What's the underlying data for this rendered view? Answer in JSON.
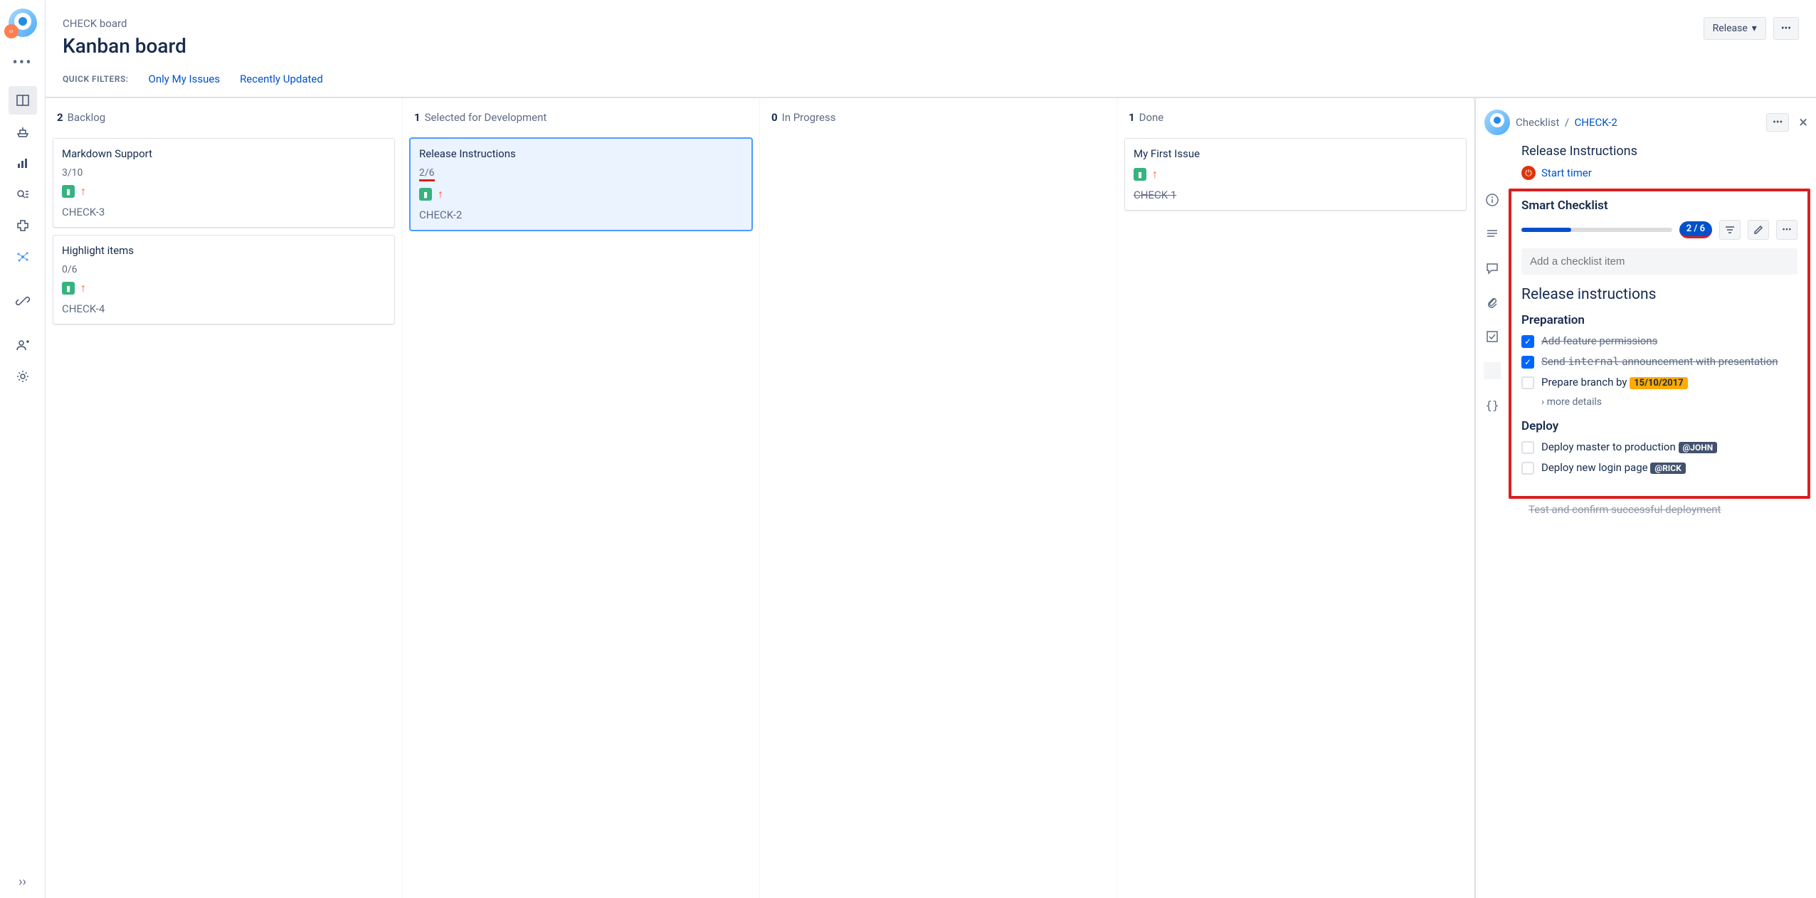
{
  "header": {
    "breadcrumb": "CHECK board",
    "title": "Kanban board",
    "release_btn": "Release"
  },
  "filters": {
    "label": "QUICK FILTERS:",
    "only_my": "Only My Issues",
    "recently": "Recently Updated"
  },
  "columns": [
    {
      "count": "2",
      "name": "Backlog"
    },
    {
      "count": "1",
      "name": "Selected for Development"
    },
    {
      "count": "0",
      "name": "In Progress"
    },
    {
      "count": "1",
      "name": "Done"
    }
  ],
  "cards": {
    "backlog": [
      {
        "title": "Markdown Support",
        "ratio": "3/10",
        "key": "CHECK-3"
      },
      {
        "title": "Highlight items",
        "ratio": "0/6",
        "key": "CHECK-4"
      }
    ],
    "selected": [
      {
        "title": "Release Instructions",
        "ratio": "2/6",
        "key": "CHECK-2"
      }
    ],
    "done": [
      {
        "title": "My First Issue",
        "key": "CHECK-1"
      }
    ]
  },
  "detail": {
    "crumb_label": "Checklist",
    "crumb_sep": "/",
    "crumb_key": "CHECK-2",
    "title": "Release Instructions",
    "timer": "Start timer"
  },
  "checklist": {
    "title": "Smart Checklist",
    "badge": "2 / 6",
    "placeholder": "Add a checklist item",
    "heading": "Release instructions",
    "section1": "Preparation",
    "item1": "Add feature permissions",
    "item2a": "Send ",
    "item2b": "internal",
    "item2c": " announcement with presentation",
    "item3": "Prepare branch by ",
    "item3_date": "15/10/2017",
    "more": "more details",
    "section2": "Deploy",
    "item4": "Deploy master to production ",
    "item4_user": "@JOHN",
    "item5": "Deploy new login page ",
    "item5_user": "@RICK",
    "cutoff": "Test and confirm successful deployment"
  }
}
